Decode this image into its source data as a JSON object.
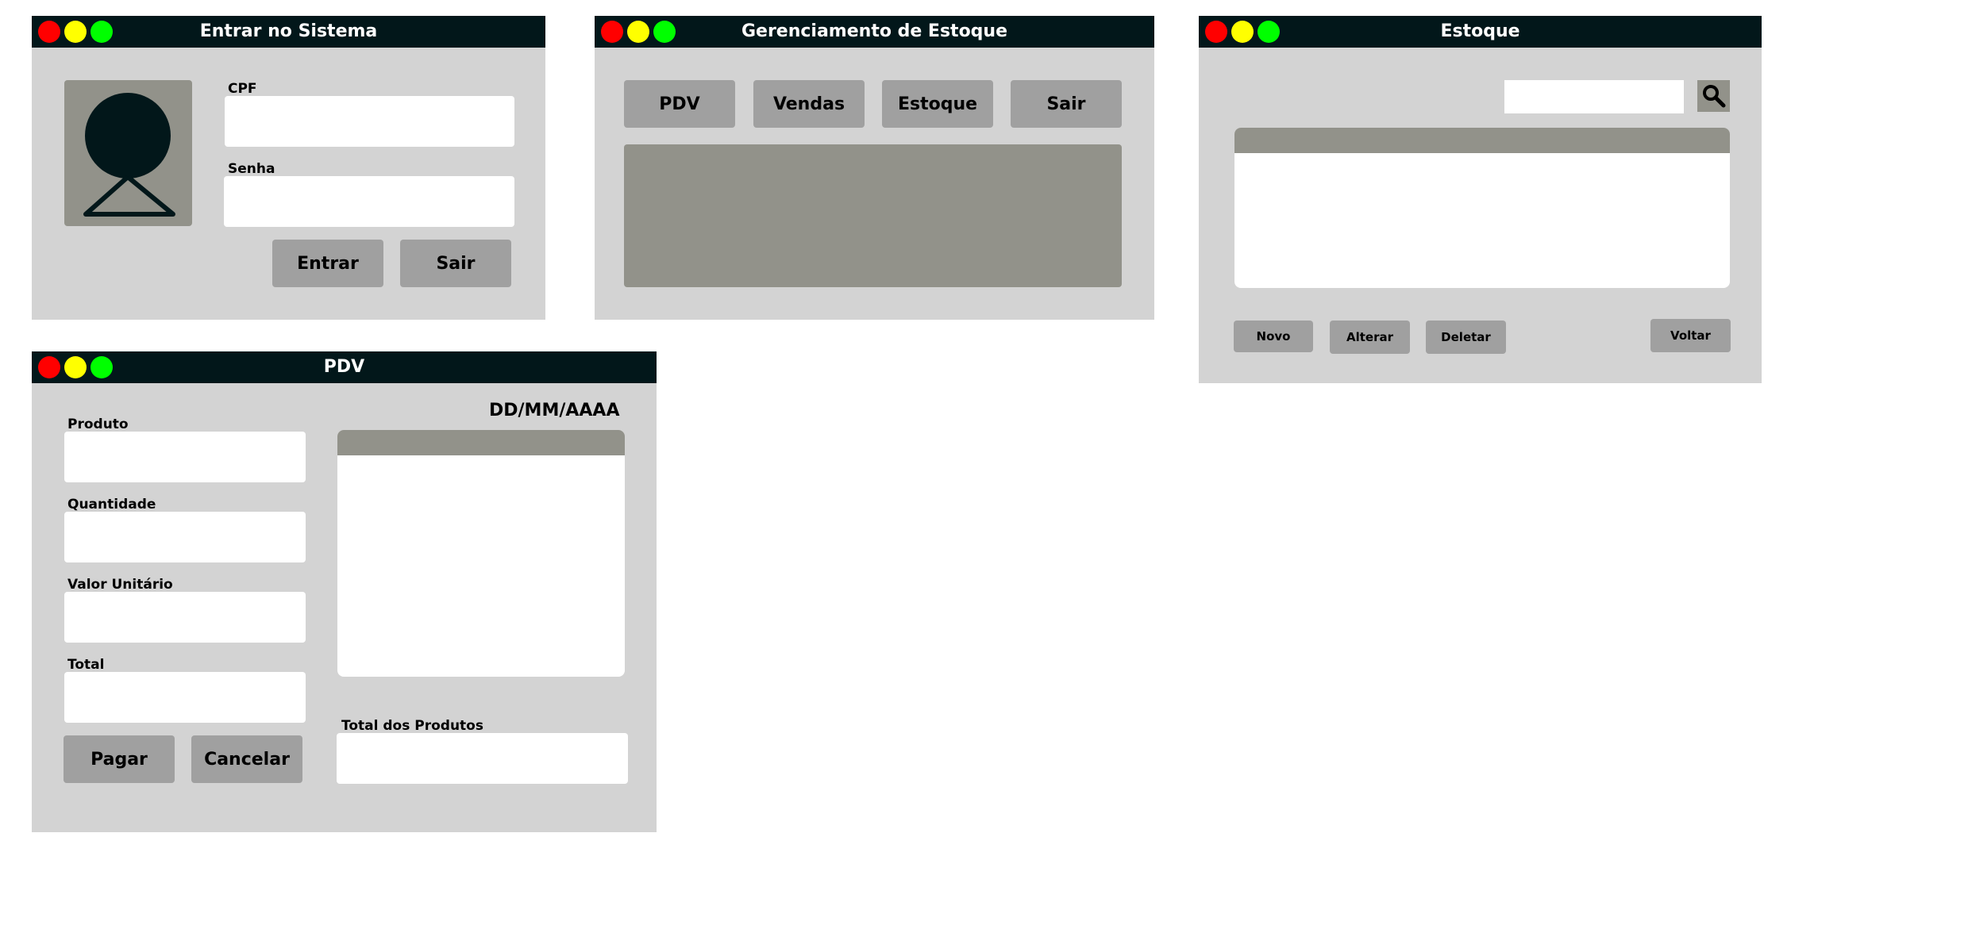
{
  "colors": {
    "titlebar": "#02171a",
    "window_bg": "#d3d3d3",
    "button": "#a0a0a0",
    "panel": "#92928a",
    "close": "#ff0000",
    "minimize": "#ffff00",
    "maximize": "#00ff00"
  },
  "login": {
    "title": "Entrar no Sistema",
    "cpf_label": "CPF",
    "cpf_value": "",
    "senha_label": "Senha",
    "senha_value": "",
    "entrar_label": "Entrar",
    "sair_label": "Sair",
    "avatar_icon": "user-avatar-icon"
  },
  "gerenciamento": {
    "title": "Gerenciamento de Estoque",
    "buttons": [
      "PDV",
      "Vendas",
      "Estoque",
      "Sair"
    ]
  },
  "estoque": {
    "title": "Estoque",
    "search_value": "",
    "search_icon": "search-icon",
    "novo_label": "Novo",
    "alterar_label": "Alterar",
    "deletar_label": "Deletar",
    "voltar_label": "Voltar"
  },
  "pdv": {
    "title": "PDV",
    "date": "DD/MM/AAAA",
    "produto_label": "Produto",
    "quantidade_label": "Quantidade",
    "valor_unitario_label": "Valor Unitário",
    "total_label": "Total",
    "total_produtos_label": "Total dos Produtos",
    "pagar_label": "Pagar",
    "cancelar_label": "Cancelar"
  }
}
